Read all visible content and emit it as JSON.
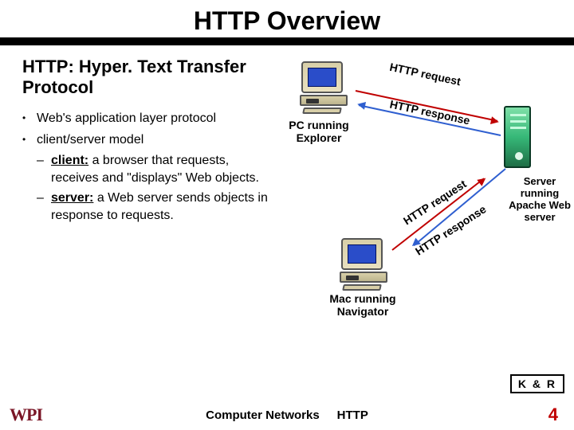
{
  "title": "HTTP Overview",
  "subtitle": "HTTP: Hyper. Text Transfer Protocol",
  "bullets": {
    "b1": "Web's application layer protocol",
    "b2": "client/server model",
    "s1_label": "client:",
    "s1_rest": "  a browser that requests, receives and \"displays\" Web objects.",
    "s2_label": "server:",
    "s2_rest": "  a Web server sends objects in response to requests."
  },
  "diagram": {
    "pc_label": "PC running Explorer",
    "mac_label": "Mac running Navigator",
    "server_label": "Server running Apache Web server",
    "req1": "HTTP request",
    "res1": "HTTP response",
    "req2": "HTTP request",
    "res2": "HTTP response"
  },
  "badge": "K & R",
  "footer": {
    "left": "Computer Networks",
    "right": "HTTP"
  },
  "page_number": "4",
  "logo_text": "WPI"
}
